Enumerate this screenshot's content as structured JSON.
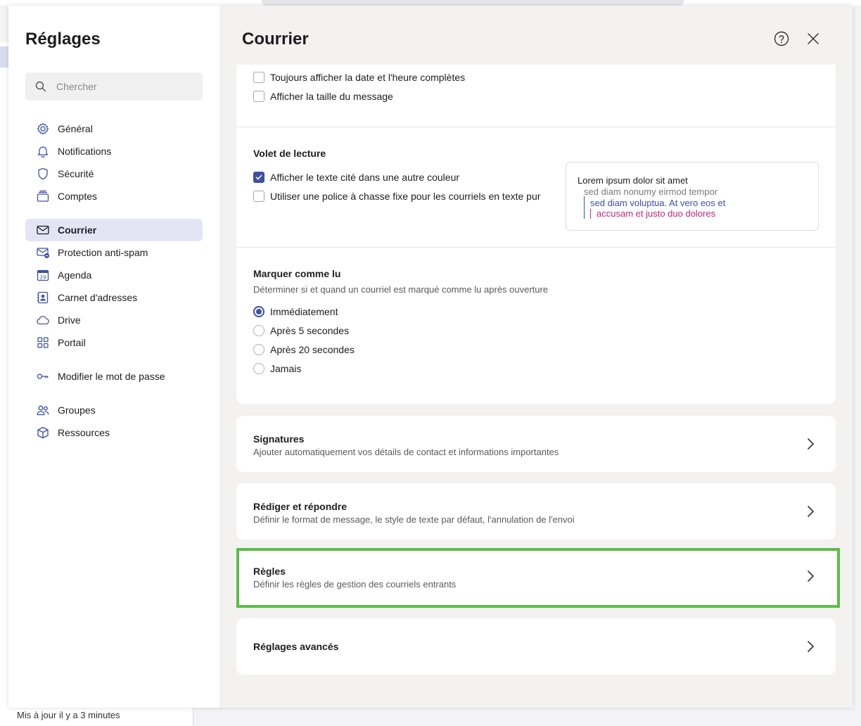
{
  "background": {
    "footer_status": "Mis à jour il y a 3 minutes"
  },
  "sidebar": {
    "title": "Réglages",
    "search_placeholder": "Chercher",
    "items": [
      {
        "label": "Général",
        "icon": "gear-icon"
      },
      {
        "label": "Notifications",
        "icon": "bell-icon"
      },
      {
        "label": "Sécurité",
        "icon": "shield-icon"
      },
      {
        "label": "Comptes",
        "icon": "accounts-icon"
      },
      {
        "label": "Courrier",
        "icon": "mail-icon",
        "active": true
      },
      {
        "label": "Protection anti-spam",
        "icon": "spam-mail-icon"
      },
      {
        "label": "Agenda",
        "icon": "calendar-icon",
        "calendar_day": "29"
      },
      {
        "label": "Carnet d'adresses",
        "icon": "address-book-icon"
      },
      {
        "label": "Drive",
        "icon": "cloud-icon"
      },
      {
        "label": "Portail",
        "icon": "grid-icon"
      },
      {
        "label": "Modifier le mot de passe",
        "icon": "key-icon"
      },
      {
        "label": "Groupes",
        "icon": "group-icon"
      },
      {
        "label": "Ressources",
        "icon": "cube-icon"
      }
    ]
  },
  "content": {
    "title": "Courrier",
    "display_options": [
      {
        "label": "Toujours afficher la date et l'heure complètes",
        "checked": false
      },
      {
        "label": "Afficher la taille du message",
        "checked": false
      }
    ],
    "reading_pane": {
      "title": "Volet de lecture",
      "options": [
        {
          "label": "Afficher le texte cité dans une autre couleur",
          "checked": true
        },
        {
          "label": "Utiliser une police à chasse fixe pour les courriels en texte pur",
          "checked": false
        }
      ],
      "preview": {
        "line1": "Lorem ipsum dolor sit amet",
        "line2": "sed diam nonumy eirmod tempor",
        "line3": "sed diam voluptua. At vero eos et",
        "line4": "accusam et justo duo dolores",
        "quote1_color": "#3d4fa8",
        "quote2_color": "#c2267e"
      }
    },
    "mark_read": {
      "title": "Marquer comme lu",
      "subtitle": "Déterminer si et quand un courriel est marqué comme lu après ouverture",
      "options": [
        {
          "label": "Immédiatement",
          "selected": true
        },
        {
          "label": "Après 5 secondes",
          "selected": false
        },
        {
          "label": "Après 20 secondes",
          "selected": false
        },
        {
          "label": "Jamais",
          "selected": false
        }
      ]
    },
    "cards": [
      {
        "title": "Signatures",
        "subtitle": "Ajouter automatiquement vos détails de contact et informations importantes"
      },
      {
        "title": "Rédiger et répondre",
        "subtitle": "Définir le format de message, le style de texte par défaut, l'annulation de l'envoi"
      },
      {
        "title": "Règles",
        "subtitle": "Définir les règles de gestion des courriels entrants",
        "highlighted": true
      },
      {
        "title": "Réglages avancés",
        "subtitle": ""
      }
    ]
  },
  "colors": {
    "accent": "#3d4fa8",
    "active_nav_bg": "#e3e5f5",
    "highlight_border": "#5cbd46"
  }
}
